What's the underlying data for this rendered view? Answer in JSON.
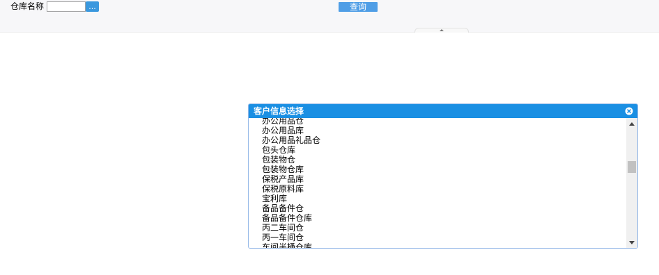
{
  "filter": {
    "label": "仓库名称",
    "value": "",
    "browse_label": "...",
    "query_label": "查询"
  },
  "dialog": {
    "title": "客户信息选择",
    "items": [
      "办公用品仓",
      "办公用品库",
      "办公用品礼品仓",
      "包头仓库",
      "包装物仓",
      "包装物仓库",
      "保税产品库",
      "保税原料库",
      "宝利库",
      "备品备件仓",
      "备品备件仓库",
      "丙二车间仓",
      "丙一车间仓",
      "车间半桶仓库"
    ]
  },
  "colors": {
    "accent": "#1a8fe3",
    "button": "#4f9ee6"
  }
}
